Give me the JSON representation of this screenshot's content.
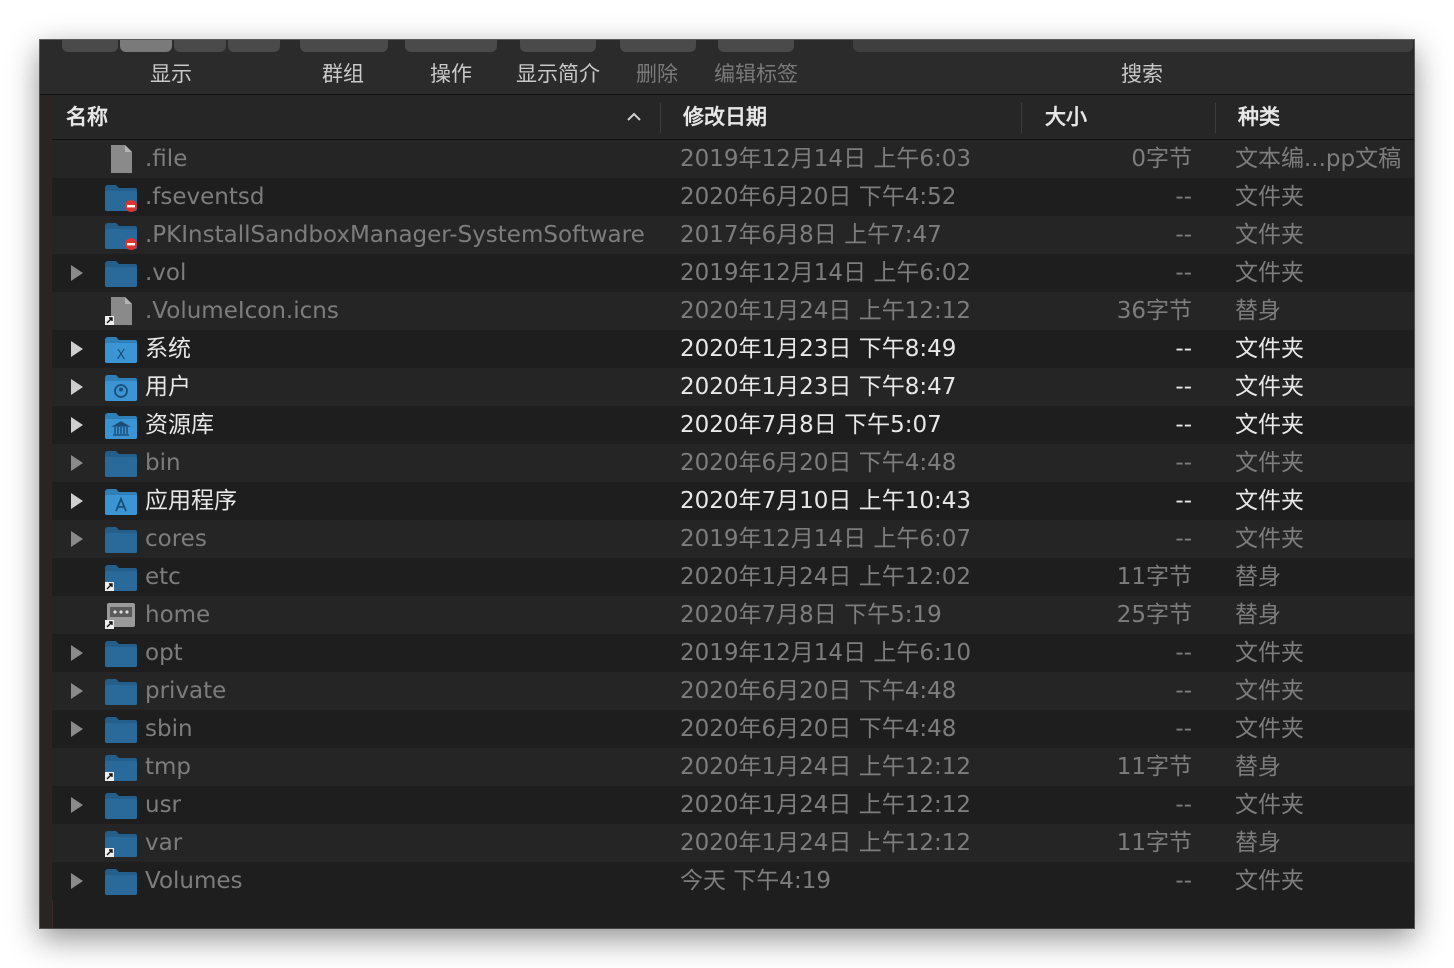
{
  "toolbar": {
    "view_label": "显示",
    "group_label": "群组",
    "action_label": "操作",
    "info_label": "显示简介",
    "delete_label": "删除",
    "tags_label": "编辑标签",
    "search_label": "搜索"
  },
  "columns": {
    "name": "名称",
    "date": "修改日期",
    "size": "大小",
    "kind": "种类"
  },
  "files": [
    {
      "name": ".file",
      "date": "2019年12月14日 上午6:03",
      "size": "0字节",
      "kind": "文本编...pp文稿",
      "icon": "document-icon",
      "expandable": false,
      "hidden": true
    },
    {
      "name": ".fseventsd",
      "date": "2020年6月20日 下午4:52",
      "size": "--",
      "kind": "文件夹",
      "icon": "restricted-folder-icon",
      "expandable": false,
      "hidden": true
    },
    {
      "name": ".PKInstallSandboxManager-SystemSoftware",
      "date": "2017年6月8日 上午7:47",
      "size": "--",
      "kind": "文件夹",
      "icon": "restricted-folder-icon",
      "expandable": false,
      "hidden": true
    },
    {
      "name": ".vol",
      "date": "2019年12月14日 上午6:02",
      "size": "--",
      "kind": "文件夹",
      "icon": "folder-icon",
      "expandable": true,
      "hidden": true
    },
    {
      "name": ".VolumeIcon.icns",
      "date": "2020年1月24日 上午12:12",
      "size": "36字节",
      "kind": "替身",
      "icon": "alias-document-icon",
      "expandable": false,
      "hidden": true
    },
    {
      "name": "系统",
      "date": "2020年1月23日 下午8:49",
      "size": "--",
      "kind": "文件夹",
      "icon": "system-folder-icon",
      "expandable": true,
      "hidden": false
    },
    {
      "name": "用户",
      "date": "2020年1月23日 下午8:47",
      "size": "--",
      "kind": "文件夹",
      "icon": "users-folder-icon",
      "expandable": true,
      "hidden": false
    },
    {
      "name": "资源库",
      "date": "2020年7月8日 下午5:07",
      "size": "--",
      "kind": "文件夹",
      "icon": "library-folder-icon",
      "expandable": true,
      "hidden": false
    },
    {
      "name": "bin",
      "date": "2020年6月20日 下午4:48",
      "size": "--",
      "kind": "文件夹",
      "icon": "folder-icon",
      "expandable": true,
      "hidden": true
    },
    {
      "name": "应用程序",
      "date": "2020年7月10日 上午10:43",
      "size": "--",
      "kind": "文件夹",
      "icon": "applications-folder-icon",
      "expandable": true,
      "hidden": false
    },
    {
      "name": "cores",
      "date": "2019年12月14日 上午6:07",
      "size": "--",
      "kind": "文件夹",
      "icon": "folder-icon",
      "expandable": true,
      "hidden": true
    },
    {
      "name": "etc",
      "date": "2020年1月24日 上午12:02",
      "size": "11字节",
      "kind": "替身",
      "icon": "alias-folder-icon",
      "expandable": false,
      "hidden": true
    },
    {
      "name": "home",
      "date": "2020年7月8日 下午5:19",
      "size": "25字节",
      "kind": "替身",
      "icon": "network-drive-alias-icon",
      "expandable": false,
      "hidden": true
    },
    {
      "name": "opt",
      "date": "2019年12月14日 上午6:10",
      "size": "--",
      "kind": "文件夹",
      "icon": "folder-icon",
      "expandable": true,
      "hidden": true
    },
    {
      "name": "private",
      "date": "2020年6月20日 下午4:48",
      "size": "--",
      "kind": "文件夹",
      "icon": "folder-icon",
      "expandable": true,
      "hidden": true
    },
    {
      "name": "sbin",
      "date": "2020年6月20日 下午4:48",
      "size": "--",
      "kind": "文件夹",
      "icon": "folder-icon",
      "expandable": true,
      "hidden": true
    },
    {
      "name": "tmp",
      "date": "2020年1月24日 上午12:12",
      "size": "11字节",
      "kind": "替身",
      "icon": "alias-folder-icon",
      "expandable": false,
      "hidden": true
    },
    {
      "name": "usr",
      "date": "2020年1月24日 上午12:12",
      "size": "--",
      "kind": "文件夹",
      "icon": "folder-icon",
      "expandable": true,
      "hidden": true
    },
    {
      "name": "var",
      "date": "2020年1月24日 上午12:12",
      "size": "11字节",
      "kind": "替身",
      "icon": "alias-folder-icon",
      "expandable": false,
      "hidden": true
    },
    {
      "name": "Volumes",
      "date": "今天 下午4:19",
      "size": "--",
      "kind": "文件夹",
      "icon": "folder-icon",
      "expandable": true,
      "hidden": true
    }
  ]
}
